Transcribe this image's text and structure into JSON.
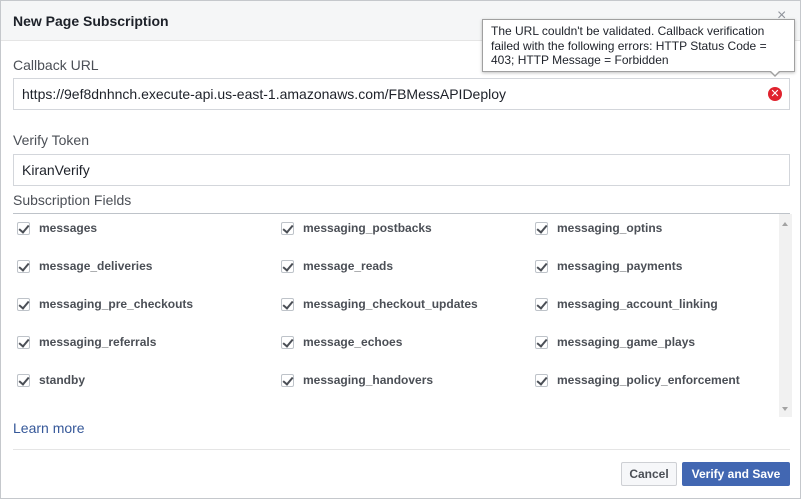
{
  "dialog": {
    "title": "New Page Subscription",
    "close_glyph": "×"
  },
  "callback": {
    "label": "Callback URL",
    "value": "https://9ef8dnhnch.execute-api.us-east-1.amazonaws.com/FBMessAPIDeploy",
    "error_icon": "error-x-icon",
    "error_glyph": "✕",
    "error_color": "#e0232e"
  },
  "tooltip": {
    "text": "The URL couldn't be validated. Callback verification failed with the following errors: HTTP Status Code = 403; HTTP Message = Forbidden"
  },
  "verify": {
    "label": "Verify Token",
    "value": "KiranVerify"
  },
  "subscription": {
    "label": "Subscription Fields",
    "fields": [
      {
        "label": "messages",
        "checked": true
      },
      {
        "label": "messaging_postbacks",
        "checked": true
      },
      {
        "label": "messaging_optins",
        "checked": true
      },
      {
        "label": "message_deliveries",
        "checked": true
      },
      {
        "label": "message_reads",
        "checked": true
      },
      {
        "label": "messaging_payments",
        "checked": true
      },
      {
        "label": "messaging_pre_checkouts",
        "checked": true
      },
      {
        "label": "messaging_checkout_updates",
        "checked": true
      },
      {
        "label": "messaging_account_linking",
        "checked": true
      },
      {
        "label": "messaging_referrals",
        "checked": true
      },
      {
        "label": "message_echoes",
        "checked": true
      },
      {
        "label": "messaging_game_plays",
        "checked": true
      },
      {
        "label": "standby",
        "checked": true
      },
      {
        "label": "messaging_handovers",
        "checked": true
      },
      {
        "label": "messaging_policy_enforcement",
        "checked": true
      }
    ]
  },
  "links": {
    "learn_more": "Learn more"
  },
  "footer": {
    "cancel_label": "Cancel",
    "save_label": "Verify and Save"
  },
  "colors": {
    "primary": "#4267b2",
    "link": "#365899"
  }
}
